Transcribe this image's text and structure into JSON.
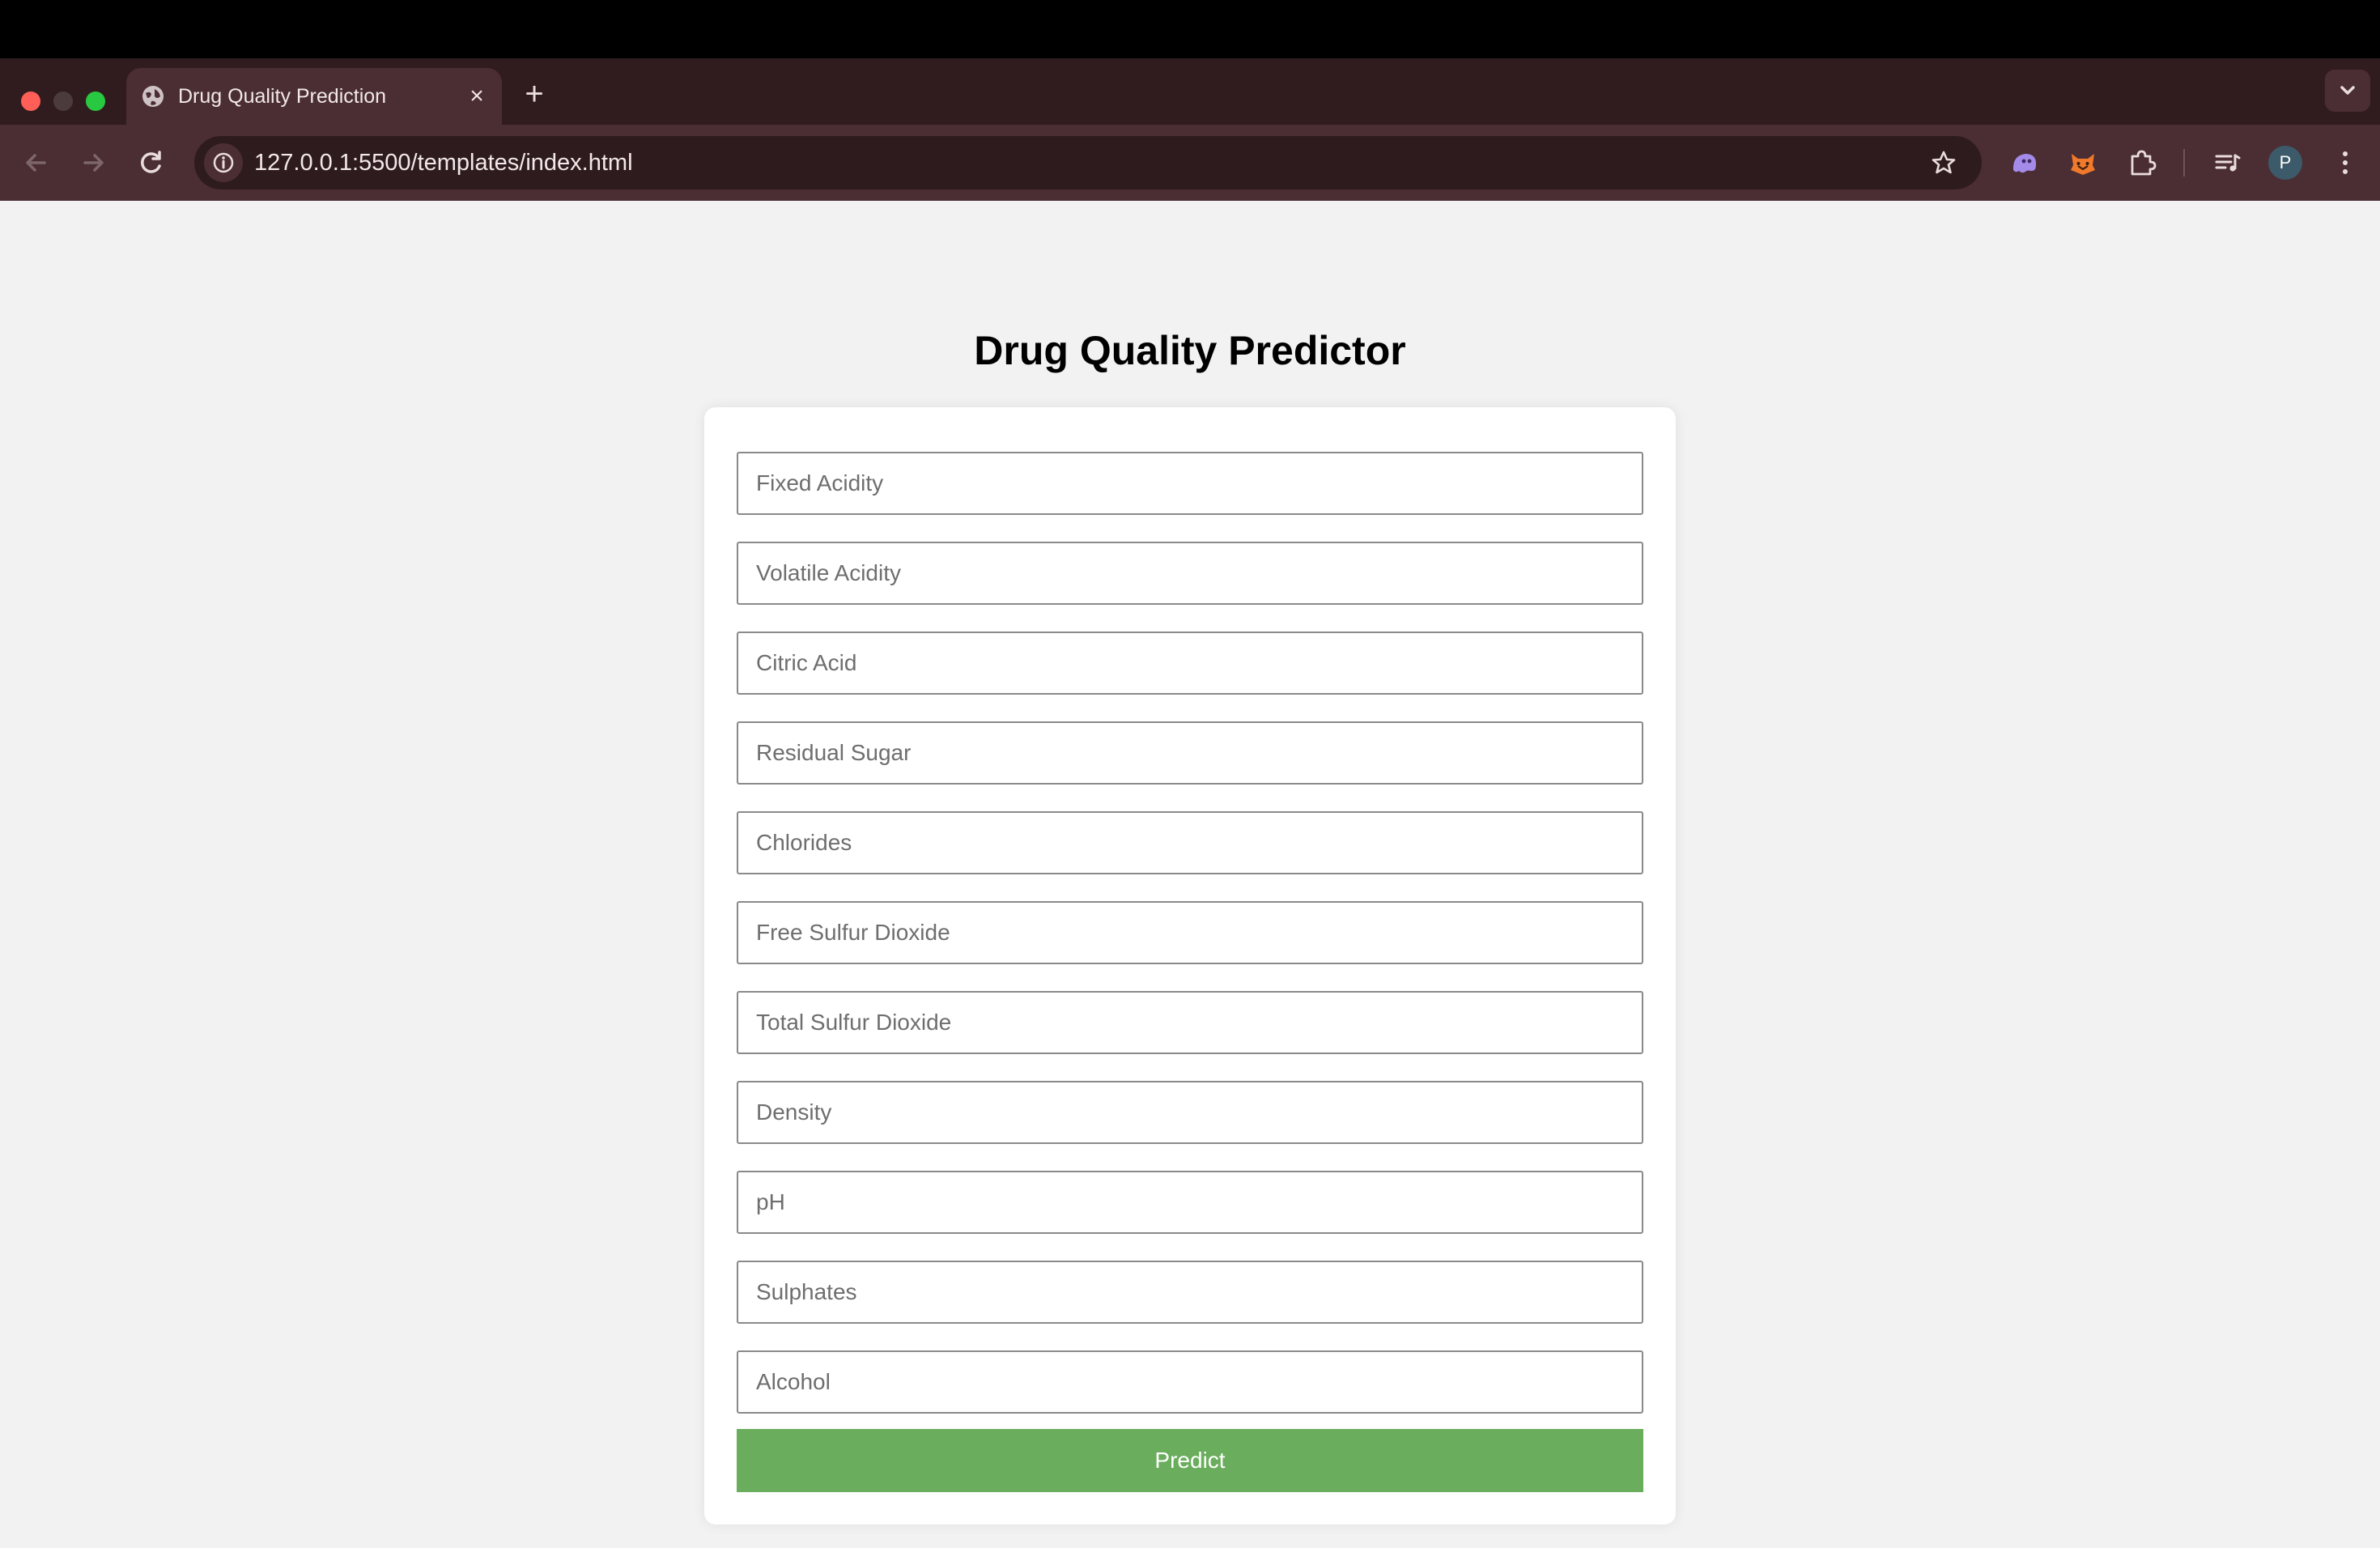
{
  "browser": {
    "tab_title": "Drug Quality Prediction",
    "url": "127.0.0.1:5500/templates/index.html",
    "avatar_initial": "P",
    "icons": {
      "globe": "globe-icon",
      "close": "close-icon",
      "new_tab": "plus-icon",
      "back": "back-arrow-icon",
      "forward": "forward-arrow-icon",
      "reload": "reload-icon",
      "site_info": "info-icon",
      "bookmark": "star-icon",
      "extensions": "puzzle-icon",
      "media": "media-queue-icon",
      "menu": "kebab-menu-icon"
    }
  },
  "page": {
    "title": "Drug Quality Predictor",
    "fields": [
      {
        "placeholder": "Fixed Acidity"
      },
      {
        "placeholder": "Volatile Acidity"
      },
      {
        "placeholder": "Citric Acid"
      },
      {
        "placeholder": "Residual Sugar"
      },
      {
        "placeholder": "Chlorides"
      },
      {
        "placeholder": "Free Sulfur Dioxide"
      },
      {
        "placeholder": "Total Sulfur Dioxide"
      },
      {
        "placeholder": "Density"
      },
      {
        "placeholder": "pH"
      },
      {
        "placeholder": "Sulphates"
      },
      {
        "placeholder": "Alcohol"
      }
    ],
    "submit_label": "Predict",
    "colors": {
      "button": "#6aad5c",
      "background": "#f2f2f2"
    }
  }
}
